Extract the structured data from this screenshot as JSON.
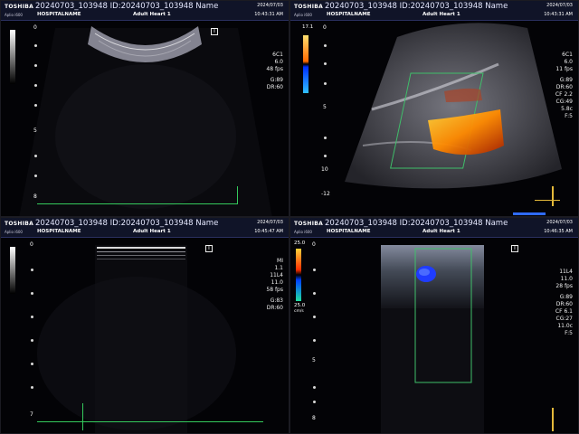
{
  "brand": "TOSHIBA",
  "panels": {
    "tl": {
      "subbrand": "Aplio i600",
      "patient": "20240703_103948 ID:20240703_103948 Name",
      "hospital": "HOSPITALNAME",
      "preset": "Adult Heart 1",
      "date": "2024/07/03",
      "time": "10:43:31 AM",
      "params": [
        "6C1",
        "6.0",
        "48 fps",
        "G:89",
        "DR:60"
      ],
      "depth_labels": [
        "0",
        "5",
        "8"
      ],
      "t_marker": "T"
    },
    "tr": {
      "subbrand": "Aplio i600",
      "patient": "20240703_103948 ID:20240703_103948 Name",
      "hospital": "HOSPITALNAME",
      "preset": "Adult Heart 1",
      "date": "2024/07/03",
      "time": "10:43:31 AM",
      "params": [
        "6C1",
        "6.0",
        "11 fps",
        "G:89",
        "DR:60",
        "CF 2.2",
        "CG:49",
        "5.8c",
        "F:5"
      ],
      "scale_top": "17.1",
      "depth_labels": [
        "0",
        "5",
        "10",
        "-12"
      ]
    },
    "bl": {
      "subbrand": "Aplio i600",
      "patient": "20240703_103948 ID:20240703_103948 Name",
      "hospital": "HOSPITALNAME",
      "preset": "Adult Heart 1",
      "date": "2024/07/03",
      "time": "10:45:47 AM",
      "params": [
        "MI",
        "1.1",
        "11L4",
        "11.0",
        "58 fps",
        "G:83",
        "DR:60"
      ],
      "depth_labels": [
        "0",
        "7"
      ],
      "t_marker": "T"
    },
    "br": {
      "subbrand": "Aplio i600",
      "patient": "20240703_103948 ID:20240703_103948 Name",
      "hospital": "HOSPITALNAME",
      "preset": "Adult Heart 1",
      "date": "2024/07/03",
      "time": "10:46:35 AM",
      "params": [
        "11L4",
        "11.0",
        "28 fps",
        "G:89",
        "DR:60",
        "CF 6.1",
        "CG:27",
        "11.0c",
        "F:5"
      ],
      "scale_top": "25.0",
      "scale_bottom": "25.0",
      "scale_unit": "cm/s",
      "depth_labels": [
        "0",
        "5",
        "8"
      ],
      "t_marker": "T"
    }
  },
  "colors": {
    "header_bg": "#101428",
    "roi_green": "#3fbf6a",
    "doppler_orange": "#ff8a00",
    "doppler_blue": "#1f3cff"
  }
}
